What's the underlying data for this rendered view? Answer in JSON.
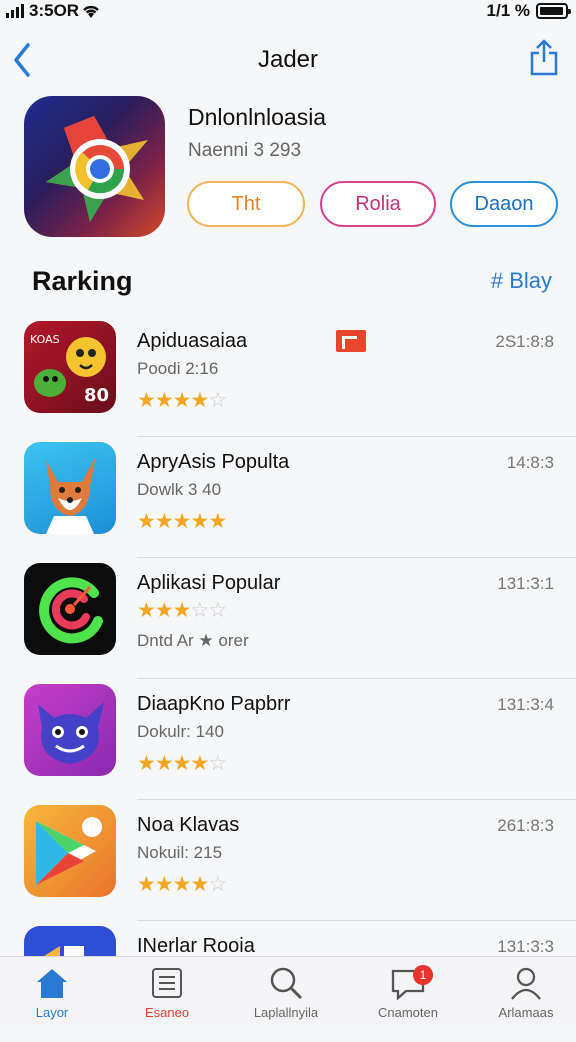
{
  "status": {
    "time": "3:5OR",
    "battery": "1/1 %"
  },
  "nav": {
    "title": "Jader"
  },
  "app": {
    "name": "Dnlonlnloasia",
    "subtitle": "Naenni 3 293",
    "pills": [
      "Tht",
      "Rolia",
      "Daaon"
    ]
  },
  "section": {
    "heading": "Rarking",
    "link": "# Blay"
  },
  "rows": [
    {
      "name": "Apiduasaiaa",
      "sub": "Poodi 2:16",
      "rating": 4,
      "score": "2S1:8:8"
    },
    {
      "name": "ApryAsis Populta",
      "sub": "Dowlk 3 40",
      "rating": 5,
      "score": "14:8:3"
    },
    {
      "name": "Aplikasi Popular",
      "sub": "Dntd Ar ★ orer",
      "rating": 3,
      "score": "131:3:1"
    },
    {
      "name": "DiaapKno Papbrr",
      "sub": "Dokulr: 140",
      "rating": 4,
      "score": "131:3:4"
    },
    {
      "name": "Noa Klavas",
      "sub": "Nokuil: 215",
      "rating": 4,
      "score": "261:8:3"
    },
    {
      "name": "INerlar Rooia",
      "sub": "",
      "rating": 0,
      "score": "131:3:3"
    }
  ],
  "tabs": [
    {
      "label": "Layor",
      "icon": "home-icon"
    },
    {
      "label": "Esaneo",
      "icon": "list-icon"
    },
    {
      "label": "Laplallnyila",
      "icon": "search-icon"
    },
    {
      "label": "Cnamoten",
      "icon": "chat-icon",
      "badge": "1"
    },
    {
      "label": "Arlamaas",
      "icon": "profile-icon"
    }
  ],
  "colors": {
    "accent": "#2a7ad5",
    "star": "#f5a623",
    "badge": "#e8322c"
  }
}
